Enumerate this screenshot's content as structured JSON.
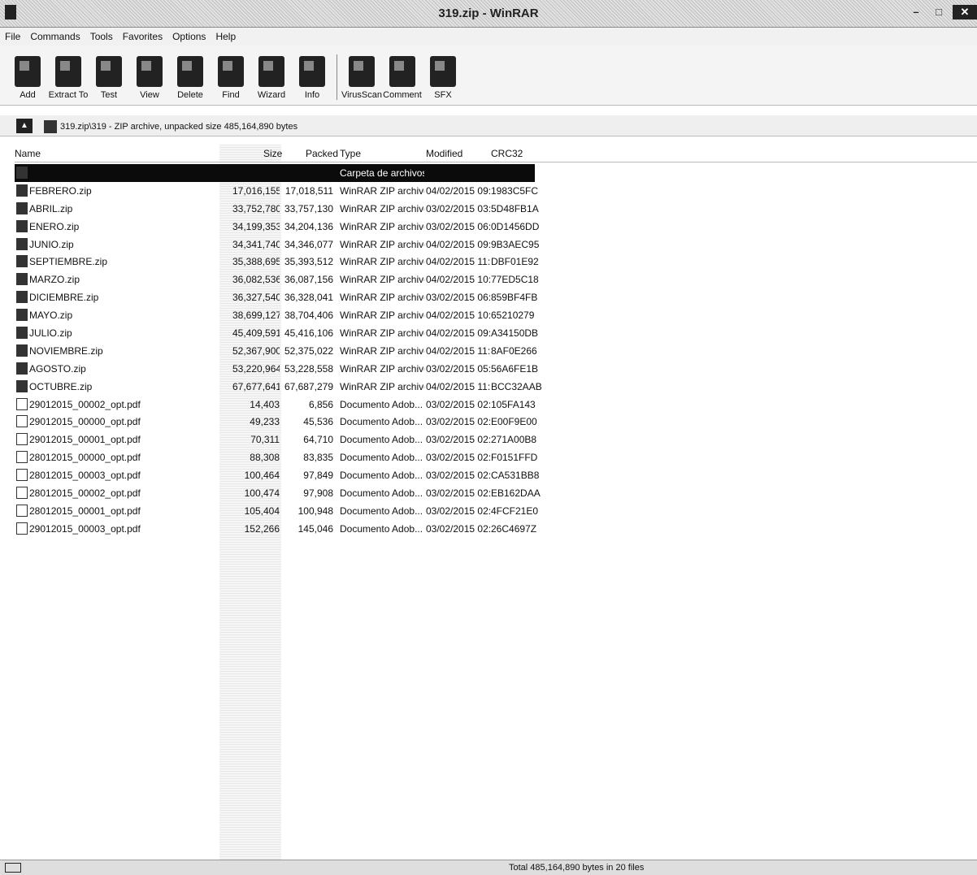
{
  "window": {
    "title": "319.zip - WinRAR",
    "min": "–",
    "max": "□",
    "close": "✕"
  },
  "menu": [
    "File",
    "Commands",
    "Tools",
    "Favorites",
    "Options",
    "Help"
  ],
  "toolbar": [
    {
      "label": "Add",
      "icon": "add-icon"
    },
    {
      "label": "Extract To",
      "icon": "extract-to-icon"
    },
    {
      "label": "Test",
      "icon": "test-icon"
    },
    {
      "label": "View",
      "icon": "view-icon"
    },
    {
      "label": "Delete",
      "icon": "delete-icon"
    },
    {
      "label": "Find",
      "icon": "find-icon"
    },
    {
      "label": "Wizard",
      "icon": "wizard-icon"
    },
    {
      "label": "Info",
      "icon": "info-icon"
    },
    {
      "label": "VirusScan",
      "icon": "virusscan-icon"
    },
    {
      "label": "Comment",
      "icon": "comment-icon"
    },
    {
      "label": "SFX",
      "icon": "sfx-icon"
    }
  ],
  "address": {
    "up_label": "▲",
    "path": "319.zip\\319 - ZIP archive, unpacked size 485,164,890 bytes"
  },
  "columns": {
    "name": "Name",
    "size": "Size",
    "packed": "Packed",
    "type": "Type",
    "modified": "Modified",
    "crc": "CRC32"
  },
  "rows": [
    {
      "name": "",
      "size": "",
      "packed": "",
      "type": "Carpeta de archivos",
      "modified": "",
      "crc": "",
      "selected": true,
      "kind": "folder"
    },
    {
      "name": "FEBRERO.zip",
      "size": "17,016,155",
      "packed": "17,018,511",
      "type": "WinRAR ZIP archive",
      "modified": "04/02/2015 09:...",
      "crc": "1983C5FC",
      "kind": "zip"
    },
    {
      "name": "ABRIL.zip",
      "size": "33,752,780",
      "packed": "33,757,130",
      "type": "WinRAR ZIP archive",
      "modified": "03/02/2015 03:...",
      "crc": "5D48FB1A",
      "kind": "zip"
    },
    {
      "name": "ENERO.zip",
      "size": "34,199,353",
      "packed": "34,204,136",
      "type": "WinRAR ZIP archive",
      "modified": "03/02/2015 06:...",
      "crc": "0D1456DD",
      "kind": "zip"
    },
    {
      "name": "JUNIO.zip",
      "size": "34,341,740",
      "packed": "34,346,077",
      "type": "WinRAR ZIP archive",
      "modified": "04/02/2015 09:...",
      "crc": "9B3AEC95",
      "kind": "zip"
    },
    {
      "name": "SEPTIEMBRE.zip",
      "size": "35,388,695",
      "packed": "35,393,512",
      "type": "WinRAR ZIP archive",
      "modified": "04/02/2015 11:...",
      "crc": "DBF01E92",
      "kind": "zip"
    },
    {
      "name": "MARZO.zip",
      "size": "36,082,536",
      "packed": "36,087,156",
      "type": "WinRAR ZIP archive",
      "modified": "04/02/2015 10:...",
      "crc": "77ED5C18",
      "kind": "zip"
    },
    {
      "name": "DICIEMBRE.zip",
      "size": "36,327,540",
      "packed": "36,328,041",
      "type": "WinRAR ZIP archive",
      "modified": "03/02/2015 06:...",
      "crc": "859BF4FB",
      "kind": "zip"
    },
    {
      "name": "MAYO.zip",
      "size": "38,699,127",
      "packed": "38,704,406",
      "type": "WinRAR ZIP archive",
      "modified": "04/02/2015 10:...",
      "crc": "65210279",
      "kind": "zip"
    },
    {
      "name": "JULIO.zip",
      "size": "45,409,591",
      "packed": "45,416,106",
      "type": "WinRAR ZIP archive",
      "modified": "04/02/2015 09:...",
      "crc": "A34150DB",
      "kind": "zip"
    },
    {
      "name": "NOVIEMBRE.zip",
      "size": "52,367,900",
      "packed": "52,375,022",
      "type": "WinRAR ZIP archive",
      "modified": "04/02/2015 11:...",
      "crc": "8AF0E266",
      "kind": "zip"
    },
    {
      "name": "AGOSTO.zip",
      "size": "53,220,964",
      "packed": "53,228,558",
      "type": "WinRAR ZIP archive",
      "modified": "03/02/2015 05:...",
      "crc": "56A6FE1B",
      "kind": "zip"
    },
    {
      "name": "OCTUBRE.zip",
      "size": "67,677,641",
      "packed": "67,687,279",
      "type": "WinRAR ZIP archive",
      "modified": "04/02/2015 11:...",
      "crc": "BCC32AAB",
      "kind": "zip"
    },
    {
      "name": "29012015_00002_opt.pdf",
      "size": "14,403",
      "packed": "6,856",
      "type": "Documento Adob...",
      "modified": "03/02/2015 02:...",
      "crc": "105FA143",
      "kind": "pdf"
    },
    {
      "name": "29012015_00000_opt.pdf",
      "size": "49,233",
      "packed": "45,536",
      "type": "Documento Adob...",
      "modified": "03/02/2015 02:...",
      "crc": "E00F9E00",
      "kind": "pdf"
    },
    {
      "name": "29012015_00001_opt.pdf",
      "size": "70,311",
      "packed": "64,710",
      "type": "Documento Adob...",
      "modified": "03/02/2015 02:...",
      "crc": "271A00B8",
      "kind": "pdf"
    },
    {
      "name": "28012015_00000_opt.pdf",
      "size": "88,308",
      "packed": "83,835",
      "type": "Documento Adob...",
      "modified": "03/02/2015 02:...",
      "crc": "F0151FFD",
      "kind": "pdf"
    },
    {
      "name": "28012015_00003_opt.pdf",
      "size": "100,464",
      "packed": "97,849",
      "type": "Documento Adob...",
      "modified": "03/02/2015 02:...",
      "crc": "CA531BB8",
      "kind": "pdf"
    },
    {
      "name": "28012015_00002_opt.pdf",
      "size": "100,474",
      "packed": "97,908",
      "type": "Documento Adob...",
      "modified": "03/02/2015 02:...",
      "crc": "EB162DAA",
      "kind": "pdf"
    },
    {
      "name": "28012015_00001_opt.pdf",
      "size": "105,404",
      "packed": "100,948",
      "type": "Documento Adob...",
      "modified": "03/02/2015 02:...",
      "crc": "4FCF21E0",
      "kind": "pdf"
    },
    {
      "name": "29012015_00003_opt.pdf",
      "size": "152,266",
      "packed": "145,046",
      "type": "Documento Adob...",
      "modified": "03/02/2015 02:...",
      "crc": "26C4697Z",
      "kind": "pdf"
    }
  ],
  "status": {
    "text": "Total 485,164,890 bytes in 20 files"
  }
}
